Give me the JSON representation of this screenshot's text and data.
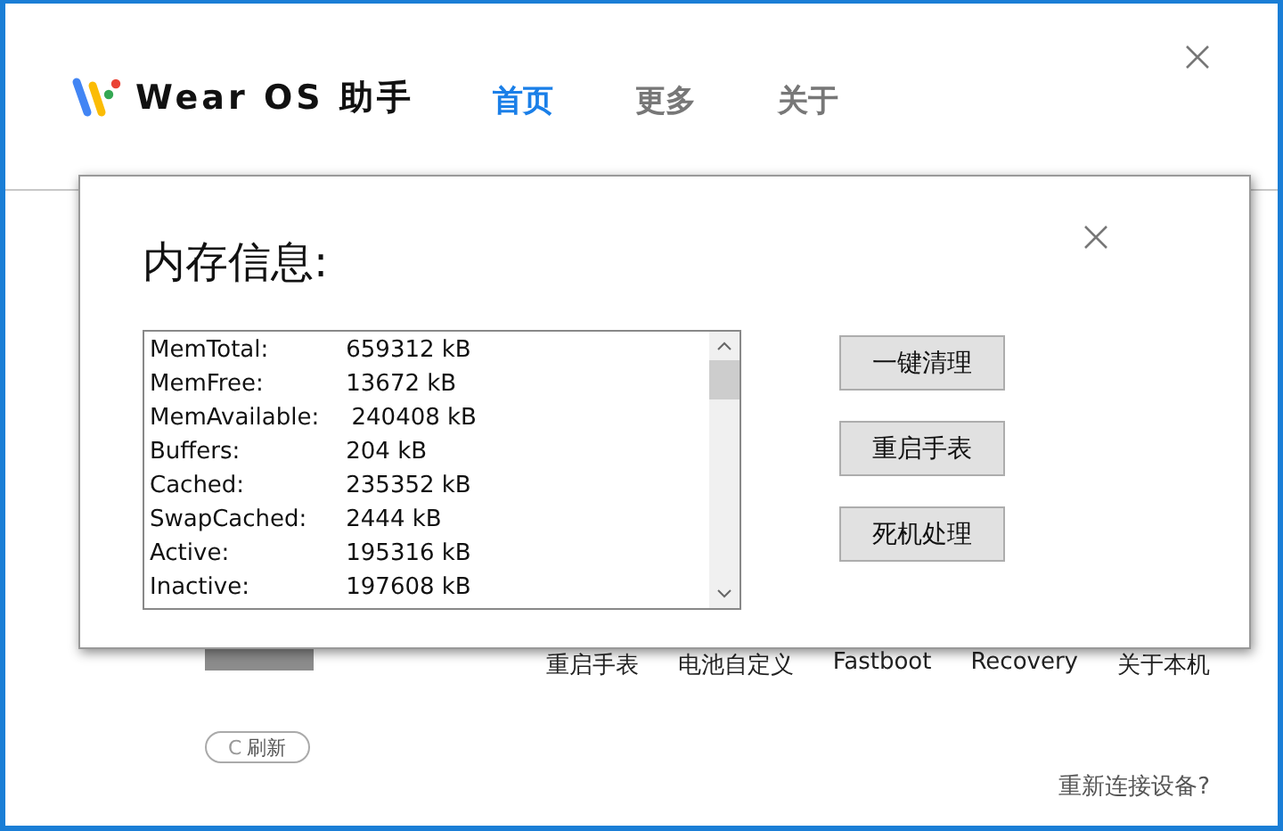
{
  "app": {
    "brand": "Wear OS 助手"
  },
  "nav": [
    {
      "label": "首页",
      "selected": true
    },
    {
      "label": "更多",
      "selected": false
    },
    {
      "label": "关于",
      "selected": false
    }
  ],
  "functions": [
    "重启手表",
    "电池自定义",
    "Fastboot",
    "Recovery",
    "关于本机"
  ],
  "refresh_button": {
    "icon": "C",
    "label": "刷新"
  },
  "reconnect_link": "重新连接设备?",
  "dialog": {
    "title": "内存信息:",
    "memory": [
      {
        "label": "MemTotal:",
        "value": "659312 kB"
      },
      {
        "label": "MemFree:",
        "value": "13672 kB"
      },
      {
        "label": "MemAvailable:",
        "value": "240408 kB"
      },
      {
        "label": "Buffers:",
        "value": "204 kB"
      },
      {
        "label": "Cached:",
        "value": "235352 kB"
      },
      {
        "label": "SwapCached:",
        "value": "2444 kB"
      },
      {
        "label": "Active:",
        "value": "195316 kB"
      },
      {
        "label": "Inactive:",
        "value": "197608 kB"
      }
    ],
    "buttons": [
      "一键清理",
      "重启手表",
      "死机处理"
    ]
  }
}
